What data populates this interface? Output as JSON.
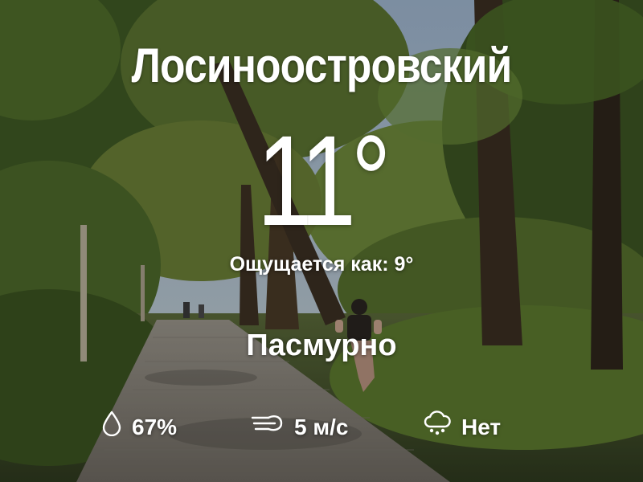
{
  "weather": {
    "location": "Лосиноостровский",
    "temperature": "11°",
    "feels_like": "Ощущается как: 9°",
    "condition": "Пасмурно"
  },
  "metrics": {
    "humidity": {
      "icon": "droplet-icon",
      "value": "67%"
    },
    "wind": {
      "icon": "wind-icon",
      "value": "5 м/с"
    },
    "precipitation": {
      "icon": "cloud-hail-icon",
      "value": "Нет"
    }
  },
  "colors": {
    "text": "#ffffff",
    "sky": "#a9bdd6",
    "foliage": "#4f6a2f",
    "path": "#8a8780"
  }
}
